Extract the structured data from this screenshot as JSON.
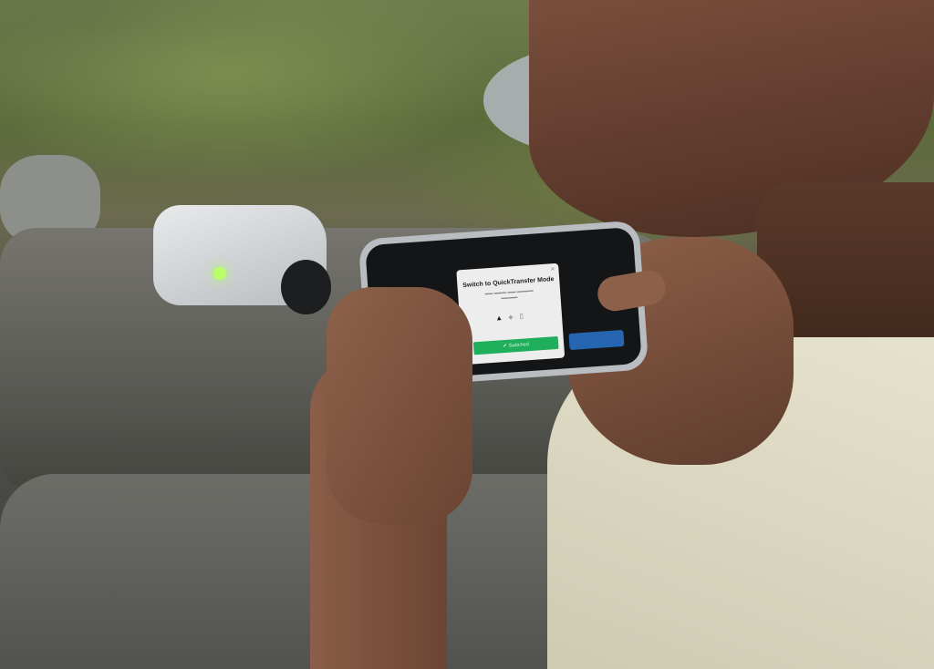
{
  "phone_dialog": {
    "title": "Switch to QuickTransfer Mode",
    "status_icons": "▲ ⟡ ▯",
    "button_label": "Switched",
    "close_icon": "close-icon",
    "button_icon": "check-circle-icon",
    "button_color": "#1fae5a"
  }
}
